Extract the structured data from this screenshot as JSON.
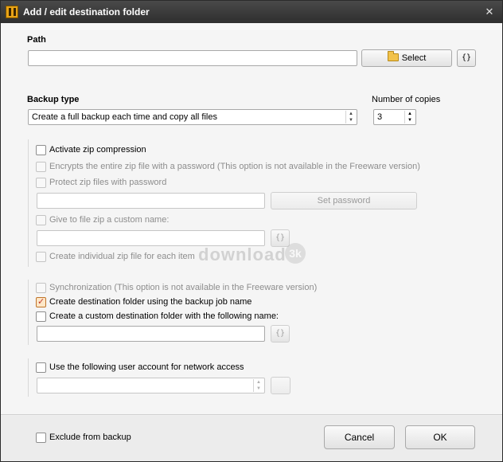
{
  "window": {
    "title": "Add / edit destination folder"
  },
  "path": {
    "label": "Path",
    "value": "",
    "select_label": "Select",
    "var_label": "{}"
  },
  "backup": {
    "type_label": "Backup type",
    "type_value": "Create a full backup each time and copy all files",
    "copies_label": "Number of copies",
    "copies_value": "3"
  },
  "zip": {
    "activate": "Activate zip compression",
    "encrypt": "Encrypts the entire zip file with a password (This option is not available in the Freeware version)",
    "protect": "Protect zip files with password",
    "set_password": "Set password",
    "custom_name": "Give to file zip a custom name:",
    "var_label": "{}",
    "individual": "Create individual zip file for each item"
  },
  "sync": {
    "synchronization": "Synchronization (This option is not available in the Freeware version)",
    "create_dest": "Create destination folder using the backup job name",
    "create_custom": "Create a custom destination folder with the following name:",
    "var_label": "{}"
  },
  "network": {
    "use_account": "Use the following user account for network access"
  },
  "watermark": {
    "text": "download",
    "badge": "3k"
  },
  "footer": {
    "exclude": "Exclude from backup",
    "cancel": "Cancel",
    "ok": "OK"
  }
}
